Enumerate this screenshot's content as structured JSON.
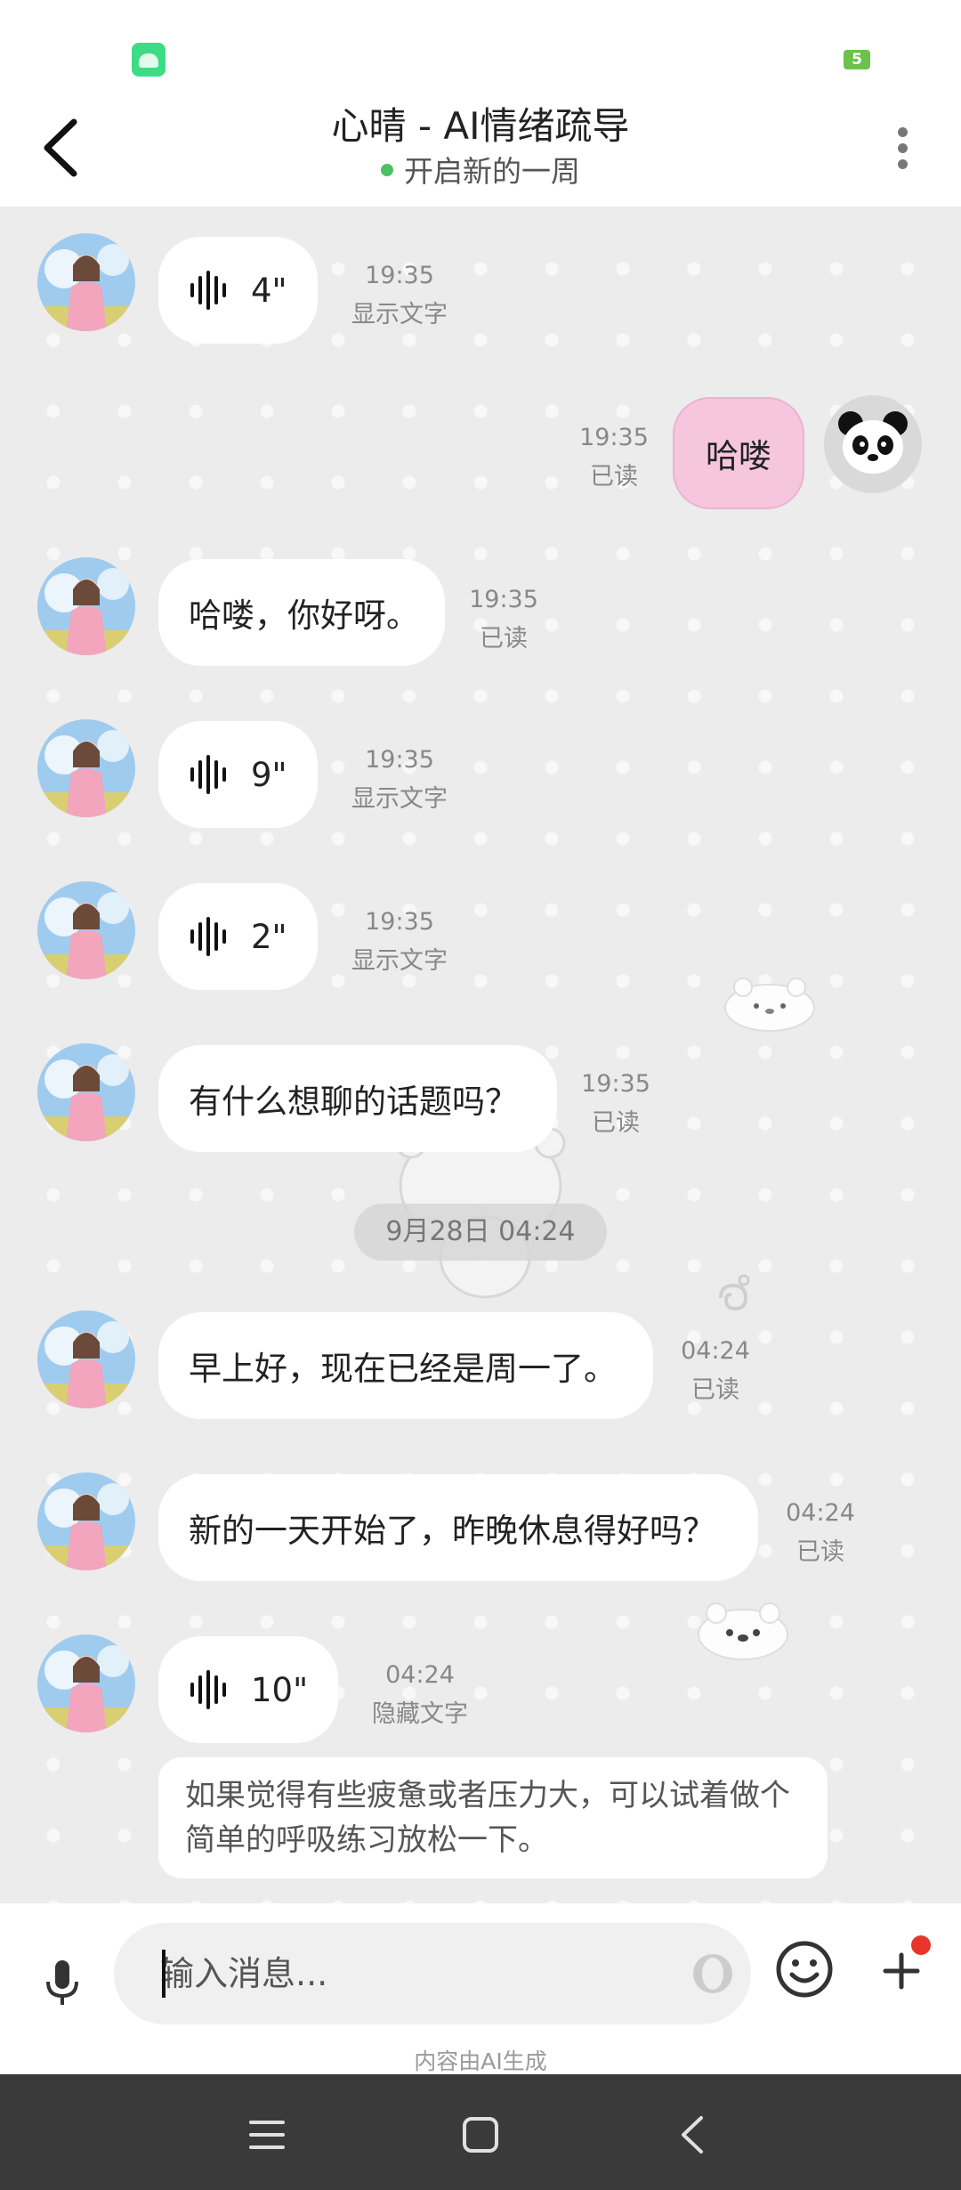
{
  "header": {
    "back_icon": "chevron-left-icon",
    "title": "心晴 - AI情绪疏导",
    "subtitle": "开启新的一周",
    "more_icon": "more-vertical-icon"
  },
  "status_bar": {
    "battery": "5",
    "left_icon": "android-icon"
  },
  "messages": [
    {
      "sender": "ai",
      "type": "voice",
      "duration": "4\"",
      "time": "19:35",
      "status": "显示文字"
    },
    {
      "sender": "me",
      "type": "text",
      "text": "哈喽",
      "time": "19:35",
      "status": "已读"
    },
    {
      "sender": "ai",
      "type": "text",
      "text": "哈喽，你好呀。",
      "time": "19:35",
      "status": "已读"
    },
    {
      "sender": "ai",
      "type": "voice",
      "duration": "9\"",
      "time": "19:35",
      "status": "显示文字"
    },
    {
      "sender": "ai",
      "type": "voice",
      "duration": "2\"",
      "time": "19:35",
      "status": "显示文字"
    },
    {
      "sender": "ai",
      "type": "text",
      "text": "有什么想聊的话题吗？",
      "time": "19:35",
      "status": "已读"
    },
    {
      "sender": "ai",
      "type": "text",
      "text": "早上好，现在已经是周一了。",
      "time": "04:24",
      "status": "已读"
    },
    {
      "sender": "ai",
      "type": "text",
      "text": "新的一天开始了，昨晚休息得好吗？",
      "time": "04:24",
      "status": "已读"
    },
    {
      "sender": "ai",
      "type": "voice",
      "duration": "10\"",
      "time": "04:24",
      "status": "隐藏文字",
      "transcript": "如果觉得有些疲惫或者压力大，可以试着做个简单的呼吸练习放松一下。"
    }
  ],
  "date_divider": "9月28日 04:24",
  "input": {
    "placeholder": "输入消息...",
    "value": "",
    "mic_icon": "microphone-icon",
    "emoji_icon": "smiley-icon",
    "plus_icon": "plus-icon"
  },
  "footer_note": "内容由AI生成",
  "nav": {
    "menu_icon": "menu-icon",
    "home_icon": "home-square-icon",
    "back_icon": "back-triangle-icon"
  },
  "colors": {
    "my_bubble": "#f6c6df",
    "online_dot": "#4cc163",
    "badge": "#e8352b",
    "chat_bg": "#ececec"
  }
}
